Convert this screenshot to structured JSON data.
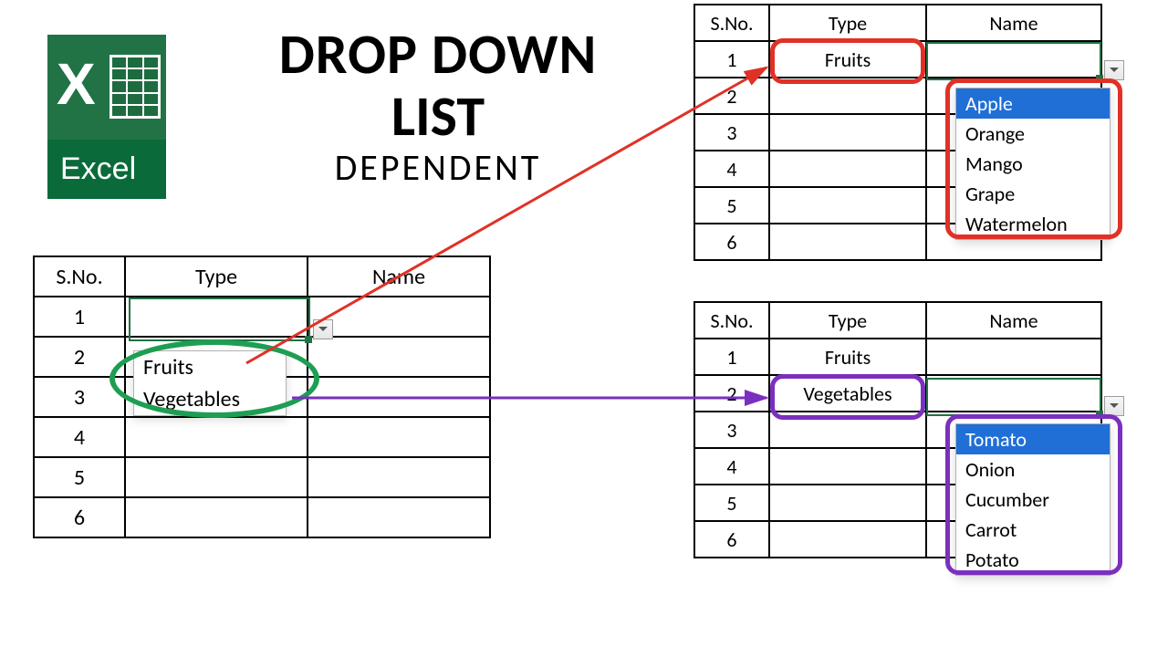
{
  "app": {
    "name": "Excel"
  },
  "title": {
    "line1": "DROP DOWN",
    "line2": "LIST",
    "line3": "DEPENDENT"
  },
  "headers": {
    "sno": "S.No.",
    "type": "Type",
    "name": "Name"
  },
  "rows_label": [
    "1",
    "2",
    "3",
    "4",
    "5",
    "6"
  ],
  "left_table": {
    "dropdown": {
      "options": [
        "Fruits",
        "Vegetables"
      ]
    }
  },
  "top_table": {
    "type_value": "Fruits",
    "dropdown": {
      "selected": "Apple",
      "options": [
        "Apple",
        "Orange",
        "Mango",
        "Grape",
        "Watermelon"
      ]
    }
  },
  "bottom_table": {
    "row1_type": "Fruits",
    "row2_type": "Vegetables",
    "dropdown": {
      "selected": "Tomato",
      "options": [
        "Tomato",
        "Onion",
        "Cucumber",
        "Carrot",
        "Potato"
      ]
    }
  },
  "colors": {
    "red": "#e03127",
    "green": "#1e9e52",
    "purple": "#7b2fbf",
    "excel": "#217346",
    "select": "#1f6fd6"
  }
}
